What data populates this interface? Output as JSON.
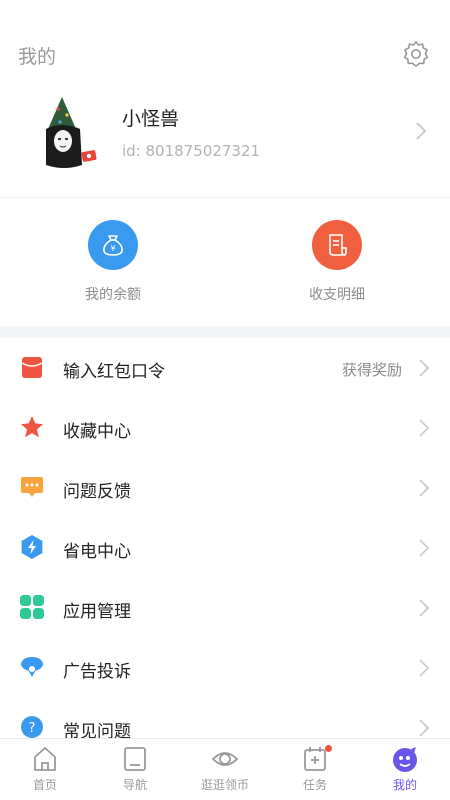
{
  "header": {
    "title": "我的",
    "settings_icon": "gear-icon"
  },
  "profile": {
    "username": "小怪兽",
    "user_id": "id: 801875027321"
  },
  "wallet": [
    {
      "label": "我的余额",
      "icon": "money-bag-icon",
      "color": "#3a9af0"
    },
    {
      "label": "收支明细",
      "icon": "receipt-icon",
      "color": "#f0603e"
    }
  ],
  "menu": [
    {
      "label": "输入红包口令",
      "hint": "获得奖励",
      "icon": "red-envelope-icon",
      "color": "#f0533f"
    },
    {
      "label": "收藏中心",
      "hint": "",
      "icon": "star-icon",
      "color": "#f0533f"
    },
    {
      "label": "问题反馈",
      "hint": "",
      "icon": "chat-bubble-icon",
      "color": "#f8a23c"
    },
    {
      "label": "省电中心",
      "hint": "",
      "icon": "lightning-hexagon-icon",
      "color": "#3a9af0"
    },
    {
      "label": "应用管理",
      "hint": "",
      "icon": "grid-icon",
      "color": "#2ecb95"
    },
    {
      "label": "广告投诉",
      "hint": "",
      "icon": "location-pin-icon",
      "color": "#3a9af0"
    },
    {
      "label": "常见问题",
      "hint": "",
      "icon": "help-icon",
      "color": "#3a9af0"
    }
  ],
  "tabbar": [
    {
      "label": "首页",
      "icon": "home-icon",
      "active": false
    },
    {
      "label": "导航",
      "icon": "navigation-icon",
      "active": false
    },
    {
      "label": "逛逛领币",
      "icon": "eye-coin-icon",
      "active": false
    },
    {
      "label": "任务",
      "icon": "task-calendar-icon",
      "active": false,
      "badge": true
    },
    {
      "label": "我的",
      "icon": "monster-profile-icon",
      "active": true
    }
  ],
  "colors": {
    "accent": "#6a57e8",
    "badge": "#f0533f",
    "muted": "#8c8c8c"
  }
}
